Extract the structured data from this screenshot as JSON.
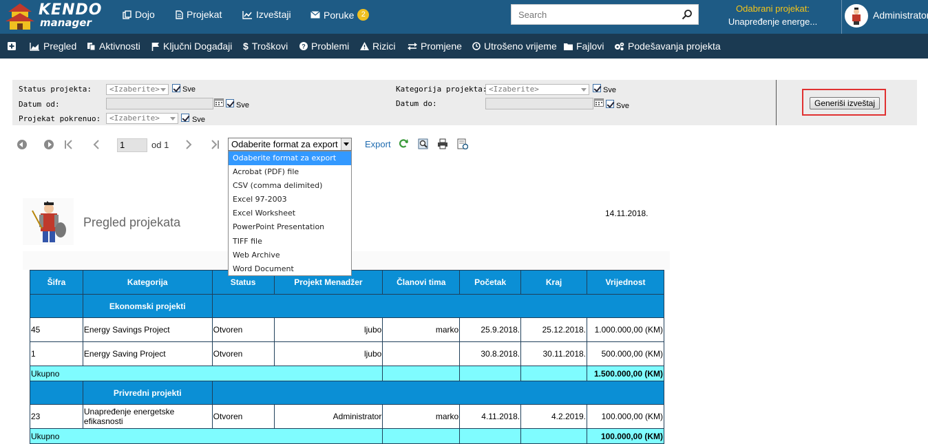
{
  "app": {
    "brand_top": "KENDO",
    "brand_bottom": "manager"
  },
  "topnav": {
    "items": [
      {
        "label": "Dojo",
        "icon": "copy-icon"
      },
      {
        "label": "Projekat",
        "icon": "document-icon"
      },
      {
        "label": "Izveštaji",
        "icon": "line-chart-icon"
      },
      {
        "label": "Poruke",
        "icon": "envelope-icon",
        "badge": "2"
      }
    ],
    "search_placeholder": "Search",
    "selected_project_label": "Odabrani projekat:",
    "selected_project_value": "Unapređenje energe...",
    "user": "Administrator"
  },
  "subnav": {
    "items": [
      {
        "label": "Pregled",
        "icon": "area-chart-icon"
      },
      {
        "label": "Aktivnosti",
        "icon": "files-icon"
      },
      {
        "label": "Ključni Događaji",
        "icon": "flag-icon"
      },
      {
        "label": "Troškovi",
        "icon": "dollar-icon"
      },
      {
        "label": "Problemi",
        "icon": "question-circle-icon"
      },
      {
        "label": "Rizici",
        "icon": "warning-icon"
      },
      {
        "label": "Promjene",
        "icon": "exchange-icon"
      },
      {
        "label": "Utrošeno vrijeme",
        "icon": "clock-icon"
      },
      {
        "label": "Fajlovi",
        "icon": "folder-icon"
      },
      {
        "label": "Podešavanja projekta",
        "icon": "cogs-icon"
      }
    ]
  },
  "filters": {
    "status_label": "Status projekta:",
    "status_value": "<Izaberite>",
    "category_label": "Kategorija projekta:",
    "category_value": "<Izaberite>",
    "date_from_label": "Datum od:",
    "date_to_label": "Datum do:",
    "started_by_label": "Projekat pokrenuo:",
    "started_by_value": "<Izaberite>",
    "all_label": "Sve",
    "generate_button": "Generiši izveštaj"
  },
  "toolbar": {
    "page_current": "1",
    "page_of": "od 1",
    "export_select": "Odaberite format za export",
    "export_link": "Export",
    "export_options": [
      "Odaberite format za export",
      "Acrobat (PDF) file",
      "CSV (comma delimited)",
      "Excel 97-2003",
      "Excel Worksheet",
      "PowerPoint Presentation",
      "TIFF file",
      "Web Archive",
      "Word Document"
    ]
  },
  "report": {
    "title": "Pregled projekata",
    "date": "14.11.2018.",
    "headers": [
      "Šifra",
      "Kategorija",
      "Status",
      "Projekt Menadžer",
      "Članovi tima",
      "Početak",
      "Kraj",
      "Vrijednost"
    ],
    "groups": [
      {
        "name": "Ekonomski projekti",
        "rows": [
          {
            "sifra": "45",
            "naziv": "Energy Savings Project",
            "status": "Otvoren",
            "menadzer": "ljubo",
            "clanovi": "marko",
            "pocetak": "25.9.2018.",
            "kraj": "25.12.2018.",
            "vrijednost": "1.000.000,00 (KM)"
          },
          {
            "sifra": "1",
            "naziv": "Energy Saving Project",
            "status": "Otvoren",
            "menadzer": "ljubo",
            "clanovi": "",
            "pocetak": "30.8.2018.",
            "kraj": "30.11.2018.",
            "vrijednost": "500.000,00 (KM)"
          }
        ],
        "total_label": "Ukupno",
        "total": "1.500.000,00 (KM)"
      },
      {
        "name": "Privredni projekti",
        "rows": [
          {
            "sifra": "23",
            "naziv": "Unapređenje energetske efikasnosti",
            "status": "Otvoren",
            "menadzer": "Administrator",
            "clanovi": "marko",
            "pocetak": "4.11.2018.",
            "kraj": "4.2.2019.",
            "vrijednost": "100.000,00 (KM)"
          }
        ],
        "total_label": "Ukupno",
        "total": "100.000,00 (KM)"
      }
    ]
  }
}
